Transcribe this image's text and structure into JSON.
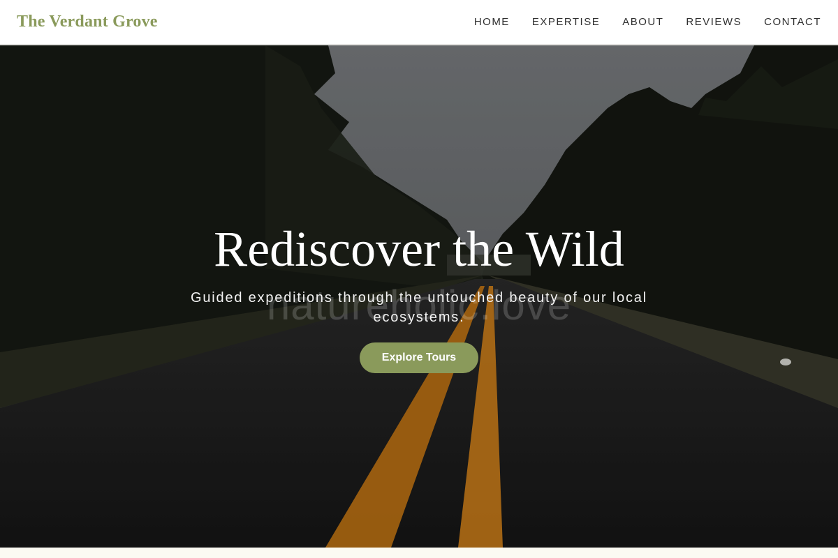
{
  "brand": {
    "name": "The Verdant Grove"
  },
  "nav": {
    "items": [
      {
        "label": "HOME"
      },
      {
        "label": "EXPERTISE"
      },
      {
        "label": "ABOUT"
      },
      {
        "label": "REVIEWS"
      },
      {
        "label": "CONTACT"
      }
    ]
  },
  "hero": {
    "title": "Rediscover the Wild",
    "subtitle": "Guided expeditions through the untouched beauty of our local ecosystems.",
    "watermark": "natureholic.love",
    "cta_label": "Explore Tours",
    "image_icon": "forest-road-image"
  },
  "colors": {
    "accent": "#8a9a5b",
    "nav_bg": "#ffffff",
    "nav_text": "#2f2f2f",
    "page_bg": "#fbfaf2",
    "road_line": "#e08a12"
  }
}
